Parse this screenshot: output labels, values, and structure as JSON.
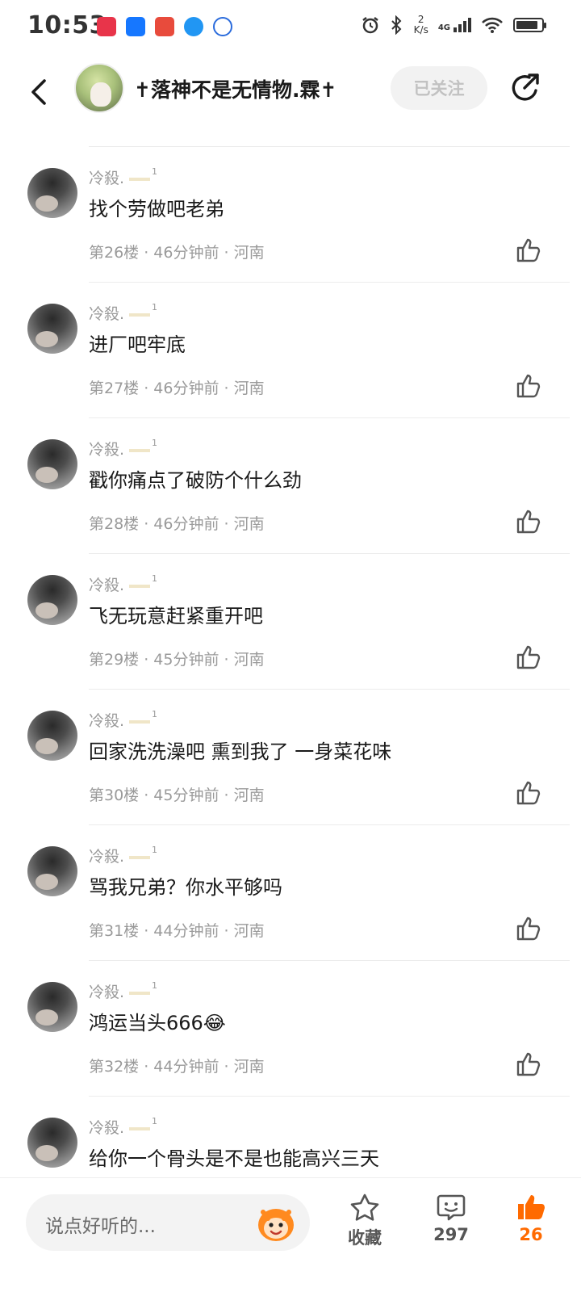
{
  "status_bar": {
    "time": "10:53",
    "net_speed_value": "2",
    "net_speed_unit": "K/s",
    "network": "4G",
    "battery_level": 0.85
  },
  "header": {
    "title": "✝落神不是无情物.霖✝",
    "follow_label": "已关注"
  },
  "comments": [
    {
      "user": "冷殺.",
      "level": "1",
      "text": "找个劳做吧老弟",
      "meta": "第26楼 · 46分钟前 · 河南"
    },
    {
      "user": "冷殺.",
      "level": "1",
      "text": "进厂吧牢底",
      "meta": "第27楼 · 46分钟前 · 河南"
    },
    {
      "user": "冷殺.",
      "level": "1",
      "text": "戳你痛点了破防个什么劲",
      "meta": "第28楼 · 46分钟前 · 河南"
    },
    {
      "user": "冷殺.",
      "level": "1",
      "text": "飞无玩意赶紧重开吧",
      "meta": "第29楼 · 45分钟前 · 河南"
    },
    {
      "user": "冷殺.",
      "level": "1",
      "text": "回家洗洗澡吧 熏到我了 一身菜花味",
      "meta": "第30楼 · 45分钟前 · 河南"
    },
    {
      "user": "冷殺.",
      "level": "1",
      "text": "骂我兄弟？你水平够吗",
      "meta": "第31楼 · 44分钟前 · 河南"
    },
    {
      "user": "冷殺.",
      "level": "1",
      "text": "鸿运当头666😂",
      "meta": "第32楼 · 44分钟前 · 河南"
    },
    {
      "user": "冷殺.",
      "level": "1",
      "text": "给你一个骨头是不是也能高兴三天",
      "meta": ""
    }
  ],
  "bottom_bar": {
    "input_placeholder": "说点好听的...",
    "favorite_label": "收藏",
    "comment_count": "297",
    "like_count": "26"
  },
  "colors": {
    "accent": "#ff6a00",
    "meta_gray": "#9a9a9a",
    "follow_bg": "#f2f2f2"
  },
  "icons": [
    "back-arrow-icon",
    "share-icon",
    "like-icon",
    "star-icon",
    "comment-icon",
    "mascot-icon"
  ]
}
